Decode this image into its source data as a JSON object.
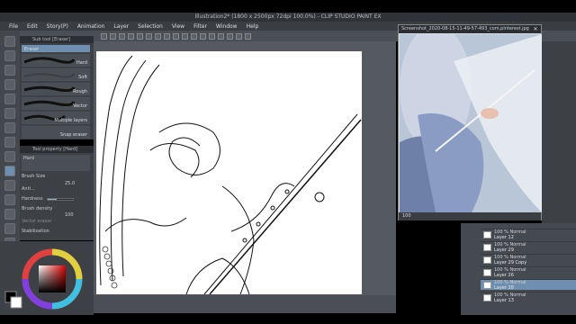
{
  "app": {
    "title": "Illustration2* (1800 x 2500px 72dpi 100.0%) - CLIP STUDIO PAINT EX"
  },
  "menu": [
    "File",
    "Edit",
    "Story(P)",
    "Animation",
    "Layer",
    "Selection",
    "View",
    "Filter",
    "Window",
    "Help"
  ],
  "subtool_panel": {
    "header": "Sub tool [Eraser]",
    "brushes": [
      {
        "label": "Eraser"
      },
      {
        "label": "Hard"
      },
      {
        "label": "Soft"
      },
      {
        "label": "Rough"
      },
      {
        "label": "Vector"
      },
      {
        "label": "Multiple layers"
      },
      {
        "label": "Snap eraser"
      }
    ]
  },
  "tool_property": {
    "header": "Tool property [Hard]",
    "preset": "Hard",
    "brush_size_label": "Brush Size",
    "brush_size_value": "25.0",
    "anti_alias_label": "Anti...",
    "hardness_label": "Hardness",
    "brush_density_label": "Brush density",
    "brush_density_value": "100",
    "vector_eraser_label": "Vector eraser",
    "stabilization_label": "Stabilization",
    "brush_density_fraction": 1.0,
    "brush_size_fraction": 0.35
  },
  "reference": {
    "title": "Screenshot_2020-08-15-11-49-57-493_com.pinterest.jpg",
    "zoom": "100"
  },
  "layers": [
    {
      "mode": "100 % Normal",
      "name": "Layer 12",
      "selected": false
    },
    {
      "mode": "100 % Normal",
      "name": "Layer 29",
      "selected": false
    },
    {
      "mode": "100 % Normal",
      "name": "Layer 29 Copy",
      "selected": false
    },
    {
      "mode": "100 % Normal",
      "name": "Layer 26",
      "selected": false
    },
    {
      "mode": "100 % Normal",
      "name": "Layer 28",
      "selected": true
    },
    {
      "mode": "100 % Normal",
      "name": "Layer 13",
      "selected": false
    }
  ],
  "colors": {
    "accent": "#6f8fb0",
    "panel": "#3d4146",
    "selected_layer": "#6f8fb0"
  }
}
